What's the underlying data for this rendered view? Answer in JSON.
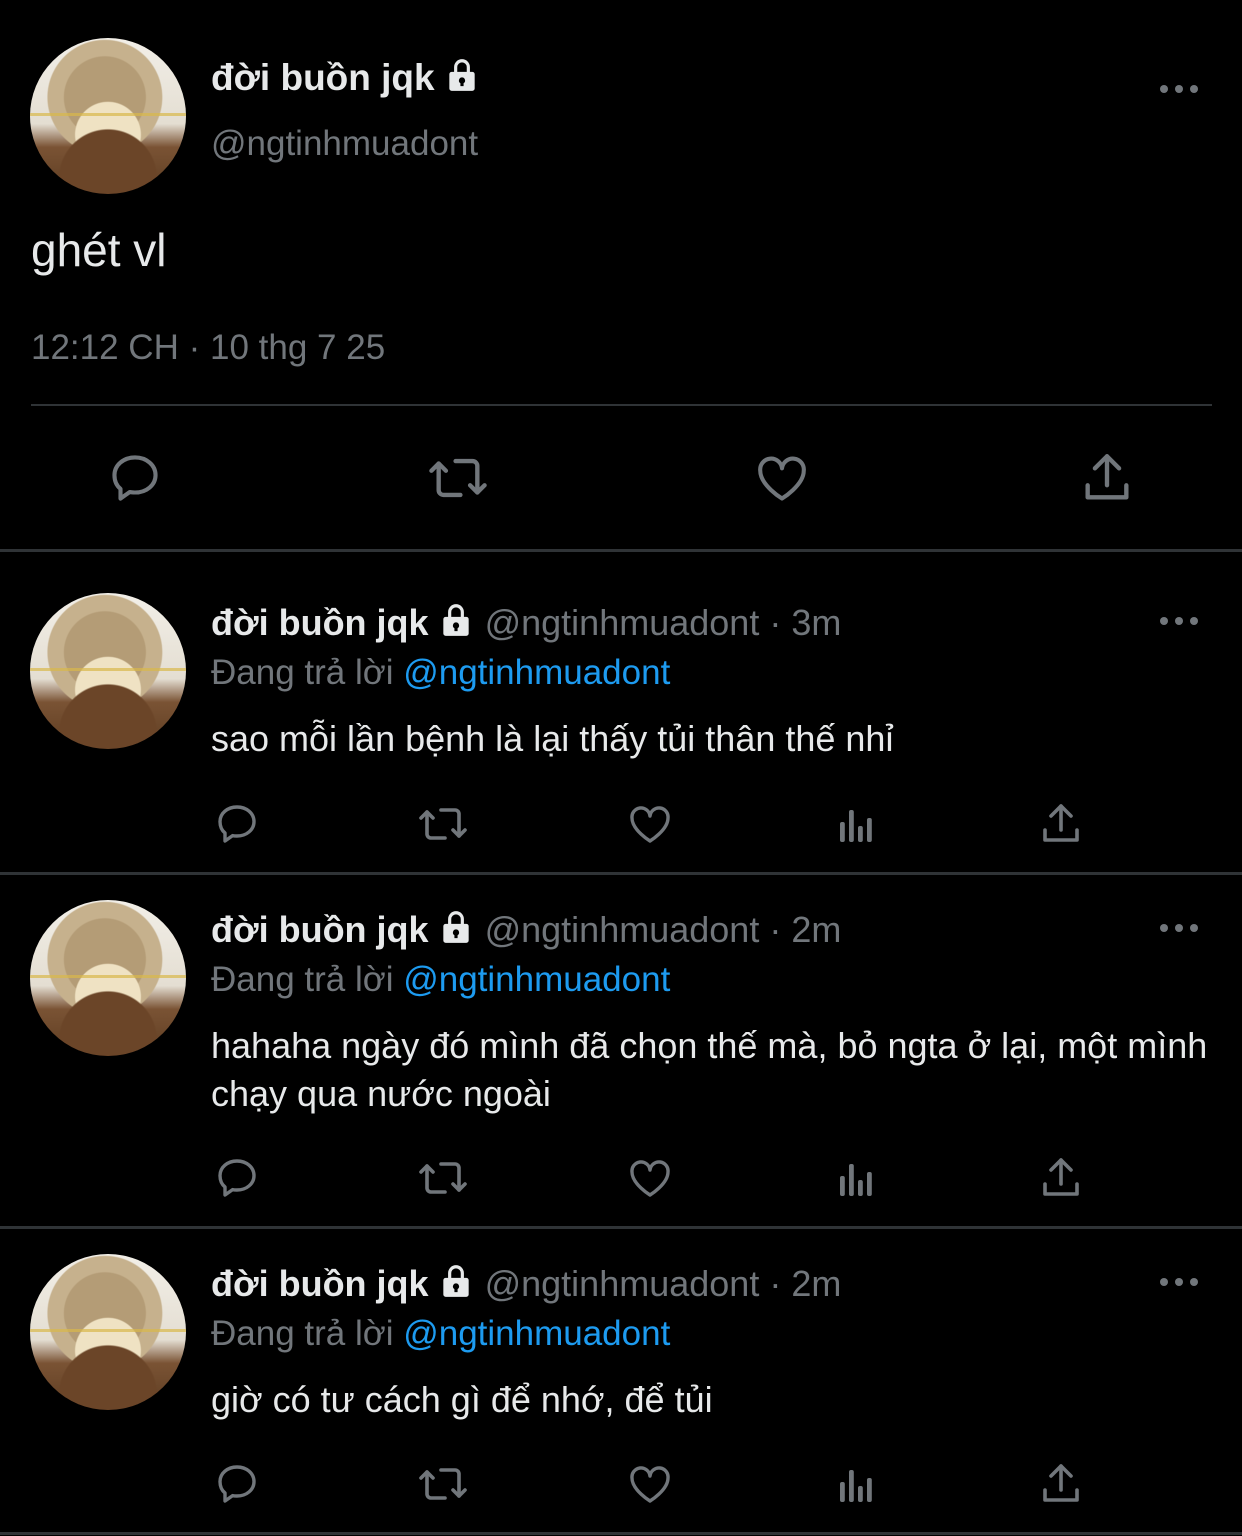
{
  "main_tweet": {
    "display_name": "đời buồn jqk",
    "handle": "@ngtinhmuadont",
    "text": "ghét vl",
    "time": "12:12 CH",
    "dot": "·",
    "date": "10 thg 7 25",
    "actions": [
      "reply-icon",
      "retweet-icon",
      "like-icon",
      "share-icon"
    ]
  },
  "replies": [
    {
      "display_name": "đời buồn jqk",
      "handle": "@ngtinhmuadont",
      "separator": "·",
      "age": "3m",
      "replying_prefix": "Đang trả lời",
      "replying_to": "@ngtinhmuadont",
      "text": "sao mỗi lần bệnh là lại thấy tủi thân thế nhỉ"
    },
    {
      "display_name": "đời buồn jqk",
      "handle": "@ngtinhmuadont",
      "separator": "·",
      "age": "2m",
      "replying_prefix": "Đang trả lời",
      "replying_to": "@ngtinhmuadont",
      "text": "hahaha ngày đó mình đã chọn thế mà, bỏ ngta ở lại, một mình chạy qua nước ngoài"
    },
    {
      "display_name": "đời buồn jqk",
      "handle": "@ngtinhmuadont",
      "separator": "·",
      "age": "2m",
      "replying_prefix": "Đang trả lời",
      "replying_to": "@ngtinhmuadont",
      "text": "giờ có tư cách gì để nhớ, để tủi"
    }
  ],
  "colors": {
    "background": "#000000",
    "primary_text": "#e7e9ea",
    "secondary_text": "#71767b",
    "link": "#1d9bf0",
    "divider": "#2f3336"
  }
}
